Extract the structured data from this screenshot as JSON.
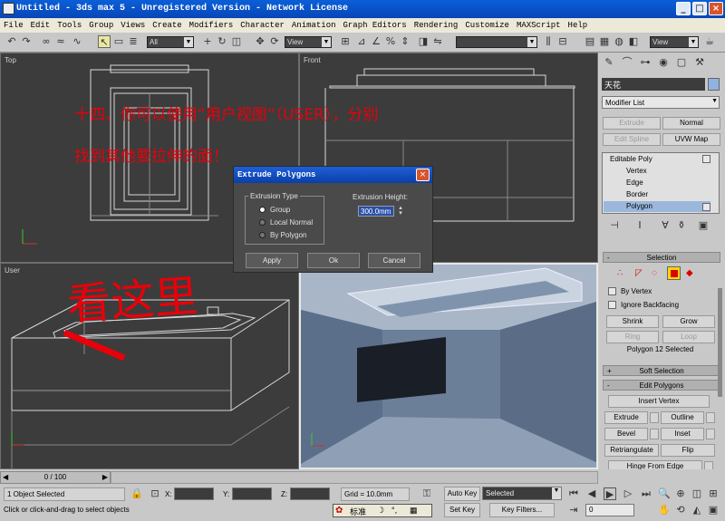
{
  "window": {
    "title": "Untitled - 3ds max 5 - Unregistered Version - Network License",
    "minimize": "_",
    "maximize": "□",
    "close": "×"
  },
  "menu": [
    "File",
    "Edit",
    "Tools",
    "Group",
    "Views",
    "Create",
    "Modifiers",
    "Character",
    "Animation",
    "Graph Editors",
    "Rendering",
    "Customize",
    "MAXScript",
    "Help"
  ],
  "toolbar": {
    "selection_filter": "All",
    "reference_coord": "View",
    "named_selection": "",
    "render_view": "View"
  },
  "viewports": {
    "top": "Top",
    "front": "Front",
    "user": "User",
    "perspective": ""
  },
  "annotation": {
    "line1": "十四、你可以使用“用户视图”（USER），分别",
    "line2": "找到其他要拉伸的面！",
    "handwriting": "看这里"
  },
  "dialog": {
    "title": "Extrude Polygons",
    "close": "×",
    "extrusion_type_label": "Extrusion Type",
    "options": [
      "Group",
      "Local Normal",
      "By Polygon"
    ],
    "selected_option": "Group",
    "height_label": "Extrusion Height:",
    "height_value": "300.0mm",
    "apply": "Apply",
    "ok": "Ok",
    "cancel": "Cancel"
  },
  "command_panel": {
    "object_name": "天花",
    "modifier_list": "Modifier List",
    "buttons": [
      "Extrude",
      "Normal",
      "Edit Spline",
      "UVW Map"
    ],
    "stack": [
      "Editable Poly",
      "Vertex",
      "Edge",
      "Border",
      "Polygon"
    ],
    "stack_selected": "Polygon",
    "selection_header": "Selection",
    "by_vertex": "By Vertex",
    "ignore_backfacing": "Ignore Backfacing",
    "shrink": "Shrink",
    "grow": "Grow",
    "ring": "Ring",
    "loop": "Loop",
    "selected_info": "Polygon 12 Selected",
    "soft_selection": "Soft Selection",
    "edit_polygons": "Edit Polygons",
    "insert_vertex": "Insert Vertex",
    "extrude": "Extrude",
    "outline": "Outline",
    "bevel": "Bevel",
    "inset": "Inset",
    "retriangulate": "Retriangulate",
    "flip": "Flip",
    "hinge_from_edge": "Hinge From Edge"
  },
  "timeline": {
    "frame": "0 / 100"
  },
  "status": {
    "selected": "1 Object Selected",
    "prompt": "Click or click-and-drag to select objects",
    "x_label": "X:",
    "y_label": "Y:",
    "z_label": "Z:",
    "grid": "Grid = 10.0mm",
    "auto_key": "Auto Key",
    "set_key": "Set Key",
    "key_mode": "Selected",
    "key_filters": "Key Filters...",
    "frame_field": "0"
  },
  "ime": {
    "mode": "标准"
  },
  "colors": {
    "accent_red": "#e8000a",
    "viewport_bg": "#3c3c3c",
    "title_blue": "#0a5fd8"
  }
}
